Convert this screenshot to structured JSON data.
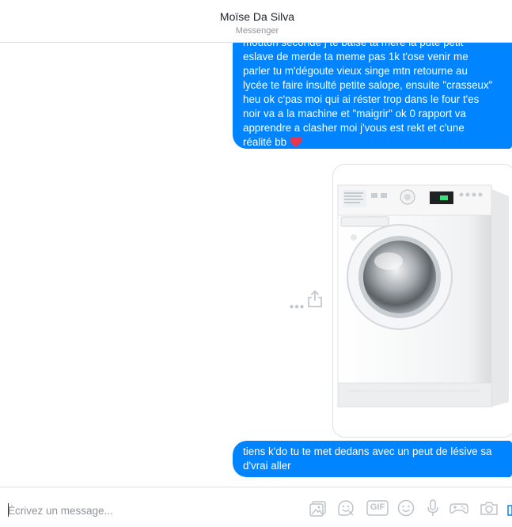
{
  "header": {
    "contact_name": "Moïse Da Silva",
    "subtitle": "Messenger"
  },
  "messages": [
    {
      "type": "text",
      "sender": "self",
      "lines": [
        "mouton seconde j te baise ta mère la pute petit",
        "eslave de merde ta meme pas 1k t'ose venir me",
        "parler tu m'dégoute vieux singe mtn retourne au",
        "lycée te faire insulté petite salope, ensuite \"crasseux\"",
        "heu ok c'pas moi qui ai réster trop dans le four t'es",
        "noir va a la machine et \"maigrir\" ok 0 rapport va",
        "apprendre a clasher moi j'vous est rekt et c'une",
        "réalité bb"
      ],
      "emoji": "heart"
    },
    {
      "type": "image",
      "sender": "self",
      "image_subject": "washing-machine"
    },
    {
      "type": "text",
      "sender": "self",
      "lines": [
        "tiens k'do tu te met dedans avec un peut de lésive sa",
        "d'vrai aller"
      ]
    }
  ],
  "composer": {
    "placeholder": "Écrivez un message...",
    "value": "",
    "tools": [
      "photo-icon",
      "sticker-icon",
      "gif-button",
      "emoji-icon",
      "microphone-icon",
      "game-controller-icon",
      "camera-icon"
    ],
    "gif_label": "GIF"
  },
  "colors": {
    "bubble": "#0084ff",
    "heart": "#e8374d",
    "icon": "#bec3c9",
    "border": "#dddfe2"
  }
}
